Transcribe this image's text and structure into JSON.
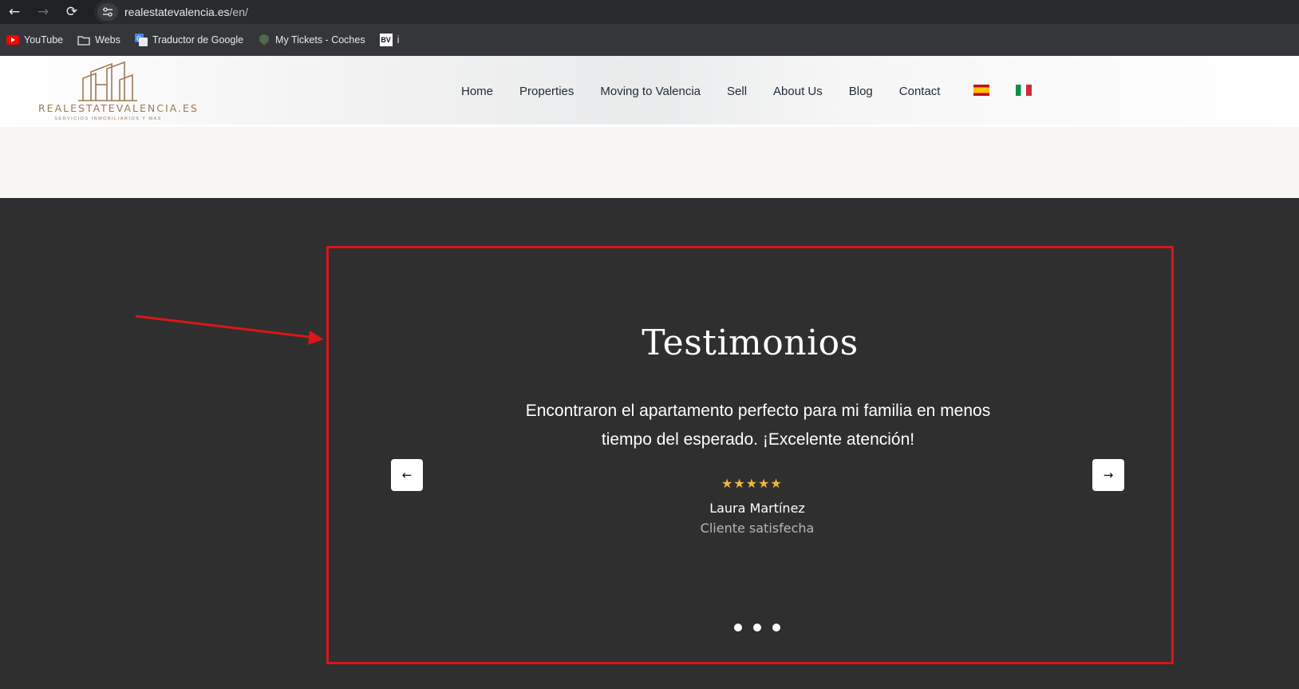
{
  "browser": {
    "url_host": "realestatevalencia.es",
    "url_path": "/en/",
    "bookmarks": [
      {
        "label": "YouTube",
        "icon": "youtube-icon"
      },
      {
        "label": "Webs",
        "icon": "folder-icon"
      },
      {
        "label": "Traductor de Google",
        "icon": "google-translate-icon"
      },
      {
        "label": "My Tickets - Coches",
        "icon": "tree-icon"
      },
      {
        "label": "i",
        "icon": "bv-icon",
        "badge": "BV"
      }
    ]
  },
  "site": {
    "logo_text": "REALESTATEVALENCIA.ES",
    "logo_sub": "SERVICIOS INMOBILIARIOS Y MAS",
    "menu": [
      "Home",
      "Properties",
      "Moving to Valencia",
      "Sell",
      "About Us",
      "Blog",
      "Contact"
    ],
    "flags": [
      "spain-flag",
      "italy-flag"
    ]
  },
  "testimonials": {
    "heading": "Testimonios",
    "quote": "Encontraron el apartamento perfecto para mi familia en menos tiempo del esperado. ¡Excelente atención!",
    "rating": 5,
    "stars": "★★★★★",
    "author": "Laura Martínez",
    "role": "Cliente satisfecha",
    "prev_label": "←",
    "next_label": "→",
    "slides": 3
  },
  "colors": {
    "frame": "#d8161b",
    "dark_bg": "#2f2f2f",
    "star": "#f4b63a",
    "brand_gold": "#9a7a58"
  }
}
